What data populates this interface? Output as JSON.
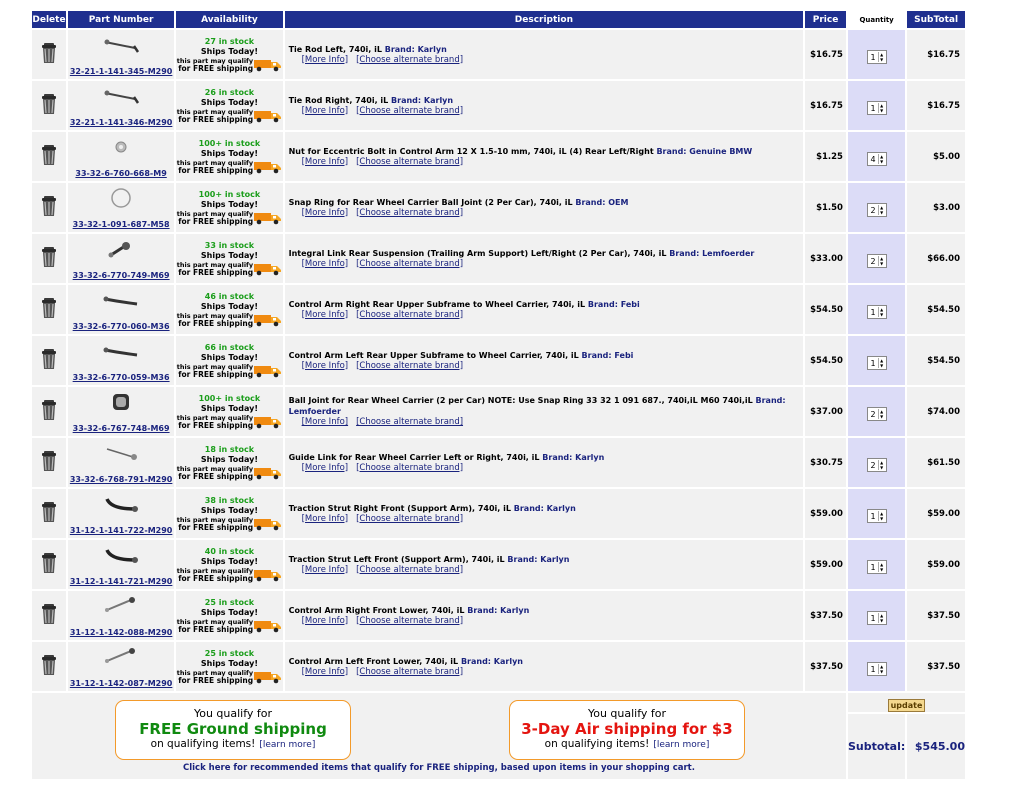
{
  "header": {
    "delete": "Delete",
    "part_number": "Part Number",
    "availability": "Availability",
    "description": "Description",
    "price": "Price",
    "quantity": "Quantity",
    "subtotal": "SubTotal"
  },
  "common": {
    "ships_today": "Ships Today!",
    "free_line1": "this part may qualify",
    "free_line2": "for FREE shipping",
    "more_info": "[More Info]",
    "alt_brand": "[Choose alternate brand]",
    "brand_prefix": "Brand: "
  },
  "items": [
    {
      "part": "32-21-1-141-345-M290",
      "stock": "27 in stock",
      "desc": "Tie Rod Left, 740i, iL",
      "brand": "Karlyn",
      "price": "$16.75",
      "qty": "1",
      "subtotal": "$16.75",
      "thumb": "tie-rod"
    },
    {
      "part": "32-21-1-141-346-M290",
      "stock": "26 in stock",
      "desc": "Tie Rod Right, 740i, iL",
      "brand": "Karlyn",
      "price": "$16.75",
      "qty": "1",
      "subtotal": "$16.75",
      "thumb": "tie-rod"
    },
    {
      "part": "33-32-6-760-668-M9",
      "stock": "100+ in stock",
      "desc": "Nut for Eccentric Bolt in Control Arm 12 X 1.5-10 mm, 740i, iL (4) Rear Left/Right",
      "brand": "Genuine BMW",
      "price": "$1.25",
      "qty": "4",
      "subtotal": "$5.00",
      "thumb": "nut"
    },
    {
      "part": "33-32-1-091-687-M58",
      "stock": "100+ in stock",
      "desc": "Snap Ring for Rear Wheel Carrier Ball Joint (2 Per Car), 740i, iL",
      "brand": "OEM",
      "price": "$1.50",
      "qty": "2",
      "subtotal": "$3.00",
      "thumb": "ring"
    },
    {
      "part": "33-32-6-770-749-M69",
      "stock": "33 in stock",
      "desc": "Integral Link Rear Suspension (Trailing Arm Support) Left/Right (2 Per Car), 740i, iL",
      "brand": "Lemfoerder",
      "price": "$33.00",
      "qty": "2",
      "subtotal": "$66.00",
      "thumb": "link"
    },
    {
      "part": "33-32-6-770-060-M36",
      "stock": "46 in stock",
      "desc": "Control Arm Right Rear Upper Subframe to Wheel Carrier, 740i, iL",
      "brand": "Febi",
      "price": "$54.50",
      "qty": "1",
      "subtotal": "$54.50",
      "thumb": "arm"
    },
    {
      "part": "33-32-6-770-059-M36",
      "stock": "66 in stock",
      "desc": "Control Arm Left Rear Upper Subframe to Wheel Carrier, 740i, iL",
      "brand": "Febi",
      "price": "$54.50",
      "qty": "1",
      "subtotal": "$54.50",
      "thumb": "arm"
    },
    {
      "part": "33-32-6-767-748-M69",
      "stock": "100+ in stock",
      "desc": "Ball Joint for Rear Wheel Carrier (2 per Car) NOTE: Use Snap Ring 33 32 1 091 687., 740i,iL M60 740i,iL",
      "brand": "Lemfoerder",
      "price": "$37.00",
      "qty": "2",
      "subtotal": "$74.00",
      "thumb": "bushing"
    },
    {
      "part": "33-32-6-768-791-M290",
      "stock": "18 in stock",
      "desc": "Guide Link for Rear Wheel Carrier Left or Right, 740i, iL",
      "brand": "Karlyn",
      "price": "$30.75",
      "qty": "2",
      "subtotal": "$61.50",
      "thumb": "guide"
    },
    {
      "part": "31-12-1-141-722-M290",
      "stock": "38 in stock",
      "desc": "Traction Strut Right Front (Support Arm), 740i, iL",
      "brand": "Karlyn",
      "price": "$59.00",
      "qty": "1",
      "subtotal": "$59.00",
      "thumb": "strut"
    },
    {
      "part": "31-12-1-141-721-M290",
      "stock": "40 in stock",
      "desc": "Traction Strut Left Front (Support Arm), 740i, iL",
      "brand": "Karlyn",
      "price": "$59.00",
      "qty": "1",
      "subtotal": "$59.00",
      "thumb": "strut"
    },
    {
      "part": "31-12-1-142-088-M290",
      "stock": "25 in stock",
      "desc": "Control Arm Right Front Lower, 740i, iL",
      "brand": "Karlyn",
      "price": "$37.50",
      "qty": "1",
      "subtotal": "$37.50",
      "thumb": "lower"
    },
    {
      "part": "31-12-1-142-087-M290",
      "stock": "25 in stock",
      "desc": "Control Arm Left Front Lower, 740i, iL",
      "brand": "Karlyn",
      "price": "$37.50",
      "qty": "1",
      "subtotal": "$37.50",
      "thumb": "lower"
    }
  ],
  "footer": {
    "promo_ground": {
      "l1": "You qualify for",
      "l2": "FREE Ground shipping",
      "l3": "on qualifying items!",
      "link": "[learn more]"
    },
    "promo_air": {
      "l1": "You qualify for",
      "l2": "3-Day Air shipping for $3",
      "l3": "on qualifying items!",
      "link": "[learn more]"
    },
    "recommend": "Click here for recommended items that qualify for FREE shipping, based upon items in your shopping cart.",
    "update": "update",
    "subtotal_label": "Subtotal:",
    "subtotal_value": "$545.00"
  },
  "colors": {
    "header_bg": "#1f2f8f",
    "link": "#1a237e",
    "stock_green": "#1b9e1b",
    "promo_border": "#f39a2a",
    "ground_green": "#108a10",
    "air_red": "#e4140f",
    "qty_col_bg": "#dcdcf7"
  },
  "icons": {
    "delete": "trash-can-icon",
    "free_shipping": "delivery-truck-icon"
  }
}
